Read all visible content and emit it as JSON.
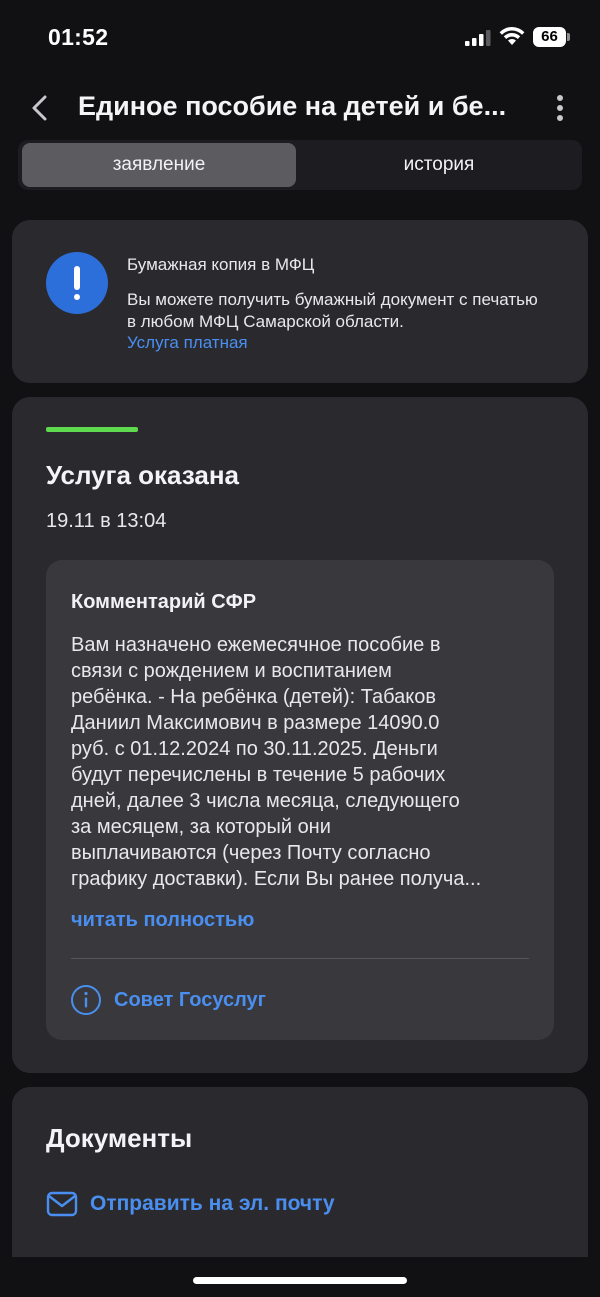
{
  "status_bar": {
    "time": "01:52",
    "battery": "66",
    "icons": [
      "signal-icon",
      "wifi-icon",
      "battery-icon"
    ]
  },
  "header": {
    "title": "Единое пособие на детей и бе...",
    "icons": [
      "chevron-left-icon",
      "more-vertical-icon"
    ]
  },
  "tabs": [
    {
      "label": "заявление",
      "active": true
    },
    {
      "label": "история",
      "active": false
    }
  ],
  "notice": {
    "icon": "exclamation-icon",
    "title": "Бумажная копия в МФЦ",
    "text": "Вы можете получить бумажный документ с печатью в любом МФЦ Самарской области.",
    "link": "Услуга платная"
  },
  "status": {
    "indicator_color": "#5fd94d",
    "title": "Услуга оказана",
    "date": "19.11 в 13:04"
  },
  "comment": {
    "title": "Комментарий СФР",
    "lines": [
      "Вам назначено ежемесячное пособие в",
      "связи с рождением и воспитанием",
      "ребёнка. - На ребёнка (детей): Табаков",
      "Даниил Максимович в размере 14090.0",
      "руб. с 01.12.2024 по 30.11.2025. Деньги",
      "будут перечислены в течение 5 рабочих",
      "дней, далее 3 числа месяца, следующего",
      "за месяцем, за который они",
      "выплачиваются (через Почту согласно",
      "графику доставки). Если Вы ранее получа..."
    ],
    "read_more": "читать полностью",
    "advice_link": "Совет Госуслуг",
    "advice_icon": "info-icon"
  },
  "documents": {
    "title": "Документы",
    "email_link": "Отправить на эл. почту",
    "email_icon": "mail-icon"
  },
  "colors": {
    "background": "#111113",
    "card": "#2a2a2e",
    "accent": "#4a8ff0",
    "success": "#5fd94d",
    "notice_icon": "#2d6fda"
  }
}
